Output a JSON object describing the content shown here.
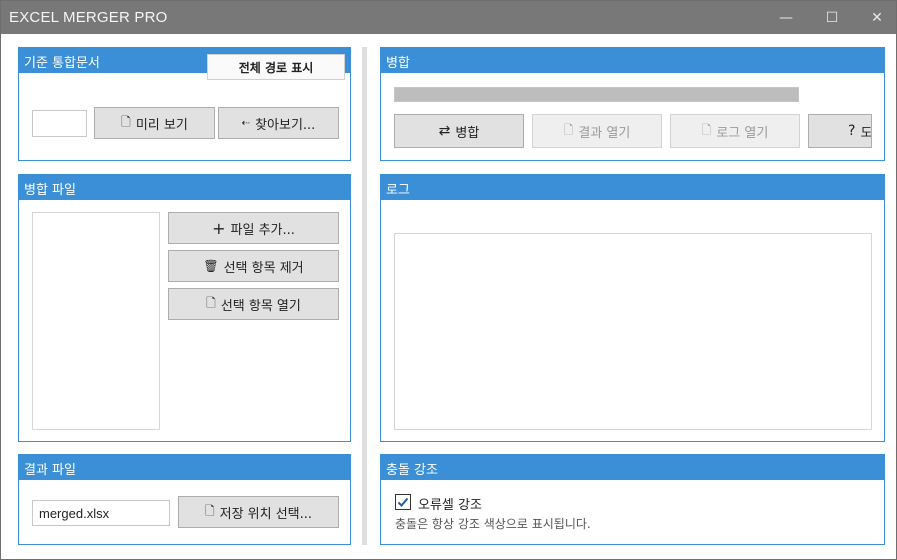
{
  "window": {
    "title": "EXCEL MERGER PRO",
    "minimize_icon": "minimize-icon",
    "maximize_icon": "maximize-icon",
    "close_icon": "close-icon"
  },
  "base_doc": {
    "header": "기준 통합문서",
    "show_full_path": "전체 경로 표시",
    "path_value": "",
    "preview": "미리 보기",
    "browse": "찾아보기..."
  },
  "merge_files": {
    "header": "병합 파일",
    "add": "파일 추가...",
    "remove": "선택 항목 제거",
    "open": "선택 항목 열기"
  },
  "result_file": {
    "header": "결과 파일",
    "filename": "merged.xlsx",
    "choose_location": "저장 위치 선택..."
  },
  "merge": {
    "header": "병합",
    "progress": 0,
    "merge_button": "병합",
    "open_result": "결과 열기",
    "open_log": "로그 열기",
    "help": "도"
  },
  "log": {
    "header": "로그"
  },
  "conflict": {
    "header": "충돌 강조",
    "checkbox_label": "오류셀 강조",
    "checked": true,
    "hint": "충돌은 항상 강조 색상으로 표시됩니다."
  },
  "colors": {
    "accent": "#3a8fd6",
    "titlebar": "#787878",
    "button": "#e1e1e1"
  }
}
